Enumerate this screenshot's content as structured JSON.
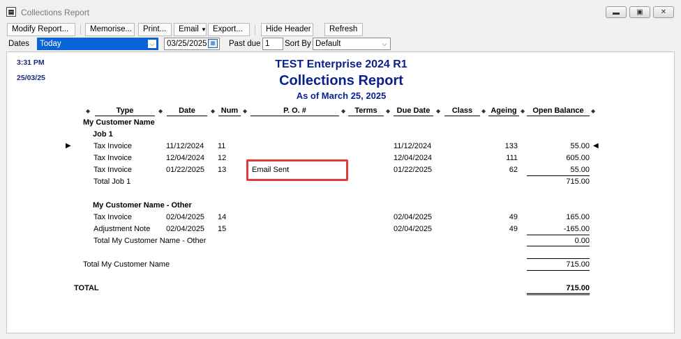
{
  "window": {
    "title": "Collections Report"
  },
  "toolbar": {
    "modify": "Modify Report...",
    "memorise": "Memorise...",
    "print": "Print...",
    "email": "Email",
    "export": "Export...",
    "hide_header": "Hide Header",
    "refresh": "Refresh"
  },
  "filters": {
    "dates_label": "Dates",
    "dates_value": "Today",
    "date": "03/25/2025",
    "past_due_label": "Past due",
    "past_due_value": "1",
    "sort_by_label": "Sort By",
    "sort_by_value": "Default"
  },
  "report": {
    "time": "3:31 PM",
    "date": "25/03/25",
    "company": "TEST Enterprise 2024 R1",
    "title": "Collections Report",
    "as_of": "As of March 25, 2025",
    "columns": [
      "Type",
      "Date",
      "Num",
      "P. O. #",
      "Terms",
      "Due Date",
      "Class",
      "Ageing",
      "Open Balance"
    ],
    "customer": "My Customer Name",
    "job1": {
      "name": "Job 1",
      "rows": [
        {
          "type": "Tax Invoice",
          "date": "11/12/2024",
          "num": "11",
          "po": "",
          "due": "11/12/2024",
          "ageing": "133",
          "balance": "55.00"
        },
        {
          "type": "Tax Invoice",
          "date": "12/04/2024",
          "num": "12",
          "po": "",
          "due": "12/04/2024",
          "ageing": "111",
          "balance": "605.00"
        },
        {
          "type": "Tax Invoice",
          "date": "01/22/2025",
          "num": "13",
          "po": "Email Sent",
          "due": "01/22/2025",
          "ageing": "62",
          "balance": "55.00"
        }
      ],
      "total_label": "Total Job 1",
      "total": "715.00"
    },
    "other": {
      "name": "My Customer Name - Other",
      "rows": [
        {
          "type": "Tax Invoice",
          "date": "02/04/2025",
          "num": "14",
          "due": "02/04/2025",
          "ageing": "49",
          "balance": "165.00"
        },
        {
          "type": "Adjustment Note",
          "date": "02/04/2025",
          "num": "15",
          "due": "02/04/2025",
          "ageing": "49",
          "balance": "-165.00"
        }
      ],
      "total_label": "Total My Customer Name - Other",
      "total": "0.00"
    },
    "customer_total_label": "Total My Customer Name",
    "customer_total": "715.00",
    "grand_total_label": "TOTAL",
    "grand_total": "715.00"
  },
  "colors": {
    "highlight": "#e33a3a",
    "title": "#0a1f8f",
    "selection": "#0a64d7"
  }
}
